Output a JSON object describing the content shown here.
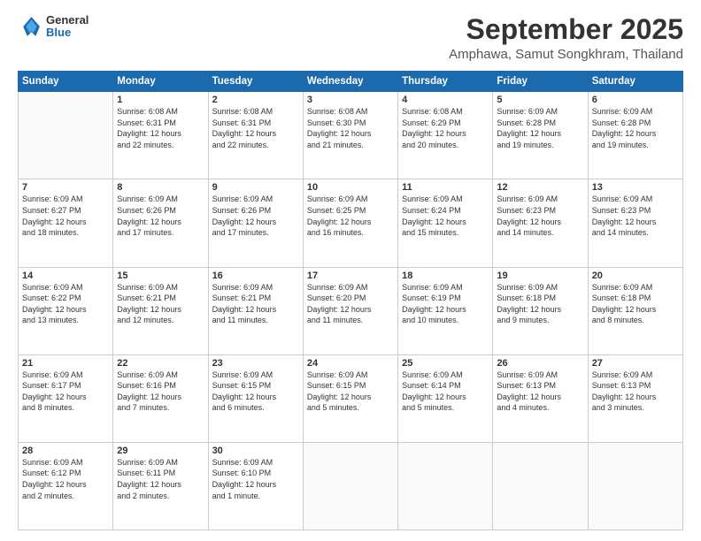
{
  "header": {
    "logo_general": "General",
    "logo_blue": "Blue",
    "month_title": "September 2025",
    "location": "Amphawa, Samut Songkhram, Thailand"
  },
  "days_of_week": [
    "Sunday",
    "Monday",
    "Tuesday",
    "Wednesday",
    "Thursday",
    "Friday",
    "Saturday"
  ],
  "weeks": [
    [
      {
        "day": "",
        "info": ""
      },
      {
        "day": "1",
        "info": "Sunrise: 6:08 AM\nSunset: 6:31 PM\nDaylight: 12 hours\nand 22 minutes."
      },
      {
        "day": "2",
        "info": "Sunrise: 6:08 AM\nSunset: 6:31 PM\nDaylight: 12 hours\nand 22 minutes."
      },
      {
        "day": "3",
        "info": "Sunrise: 6:08 AM\nSunset: 6:30 PM\nDaylight: 12 hours\nand 21 minutes."
      },
      {
        "day": "4",
        "info": "Sunrise: 6:08 AM\nSunset: 6:29 PM\nDaylight: 12 hours\nand 20 minutes."
      },
      {
        "day": "5",
        "info": "Sunrise: 6:09 AM\nSunset: 6:28 PM\nDaylight: 12 hours\nand 19 minutes."
      },
      {
        "day": "6",
        "info": "Sunrise: 6:09 AM\nSunset: 6:28 PM\nDaylight: 12 hours\nand 19 minutes."
      }
    ],
    [
      {
        "day": "7",
        "info": "Sunrise: 6:09 AM\nSunset: 6:27 PM\nDaylight: 12 hours\nand 18 minutes."
      },
      {
        "day": "8",
        "info": "Sunrise: 6:09 AM\nSunset: 6:26 PM\nDaylight: 12 hours\nand 17 minutes."
      },
      {
        "day": "9",
        "info": "Sunrise: 6:09 AM\nSunset: 6:26 PM\nDaylight: 12 hours\nand 17 minutes."
      },
      {
        "day": "10",
        "info": "Sunrise: 6:09 AM\nSunset: 6:25 PM\nDaylight: 12 hours\nand 16 minutes."
      },
      {
        "day": "11",
        "info": "Sunrise: 6:09 AM\nSunset: 6:24 PM\nDaylight: 12 hours\nand 15 minutes."
      },
      {
        "day": "12",
        "info": "Sunrise: 6:09 AM\nSunset: 6:23 PM\nDaylight: 12 hours\nand 14 minutes."
      },
      {
        "day": "13",
        "info": "Sunrise: 6:09 AM\nSunset: 6:23 PM\nDaylight: 12 hours\nand 14 minutes."
      }
    ],
    [
      {
        "day": "14",
        "info": "Sunrise: 6:09 AM\nSunset: 6:22 PM\nDaylight: 12 hours\nand 13 minutes."
      },
      {
        "day": "15",
        "info": "Sunrise: 6:09 AM\nSunset: 6:21 PM\nDaylight: 12 hours\nand 12 minutes."
      },
      {
        "day": "16",
        "info": "Sunrise: 6:09 AM\nSunset: 6:21 PM\nDaylight: 12 hours\nand 11 minutes."
      },
      {
        "day": "17",
        "info": "Sunrise: 6:09 AM\nSunset: 6:20 PM\nDaylight: 12 hours\nand 11 minutes."
      },
      {
        "day": "18",
        "info": "Sunrise: 6:09 AM\nSunset: 6:19 PM\nDaylight: 12 hours\nand 10 minutes."
      },
      {
        "day": "19",
        "info": "Sunrise: 6:09 AM\nSunset: 6:18 PM\nDaylight: 12 hours\nand 9 minutes."
      },
      {
        "day": "20",
        "info": "Sunrise: 6:09 AM\nSunset: 6:18 PM\nDaylight: 12 hours\nand 8 minutes."
      }
    ],
    [
      {
        "day": "21",
        "info": "Sunrise: 6:09 AM\nSunset: 6:17 PM\nDaylight: 12 hours\nand 8 minutes."
      },
      {
        "day": "22",
        "info": "Sunrise: 6:09 AM\nSunset: 6:16 PM\nDaylight: 12 hours\nand 7 minutes."
      },
      {
        "day": "23",
        "info": "Sunrise: 6:09 AM\nSunset: 6:15 PM\nDaylight: 12 hours\nand 6 minutes."
      },
      {
        "day": "24",
        "info": "Sunrise: 6:09 AM\nSunset: 6:15 PM\nDaylight: 12 hours\nand 5 minutes."
      },
      {
        "day": "25",
        "info": "Sunrise: 6:09 AM\nSunset: 6:14 PM\nDaylight: 12 hours\nand 5 minutes."
      },
      {
        "day": "26",
        "info": "Sunrise: 6:09 AM\nSunset: 6:13 PM\nDaylight: 12 hours\nand 4 minutes."
      },
      {
        "day": "27",
        "info": "Sunrise: 6:09 AM\nSunset: 6:13 PM\nDaylight: 12 hours\nand 3 minutes."
      }
    ],
    [
      {
        "day": "28",
        "info": "Sunrise: 6:09 AM\nSunset: 6:12 PM\nDaylight: 12 hours\nand 2 minutes."
      },
      {
        "day": "29",
        "info": "Sunrise: 6:09 AM\nSunset: 6:11 PM\nDaylight: 12 hours\nand 2 minutes."
      },
      {
        "day": "30",
        "info": "Sunrise: 6:09 AM\nSunset: 6:10 PM\nDaylight: 12 hours\nand 1 minute."
      },
      {
        "day": "",
        "info": ""
      },
      {
        "day": "",
        "info": ""
      },
      {
        "day": "",
        "info": ""
      },
      {
        "day": "",
        "info": ""
      }
    ]
  ]
}
